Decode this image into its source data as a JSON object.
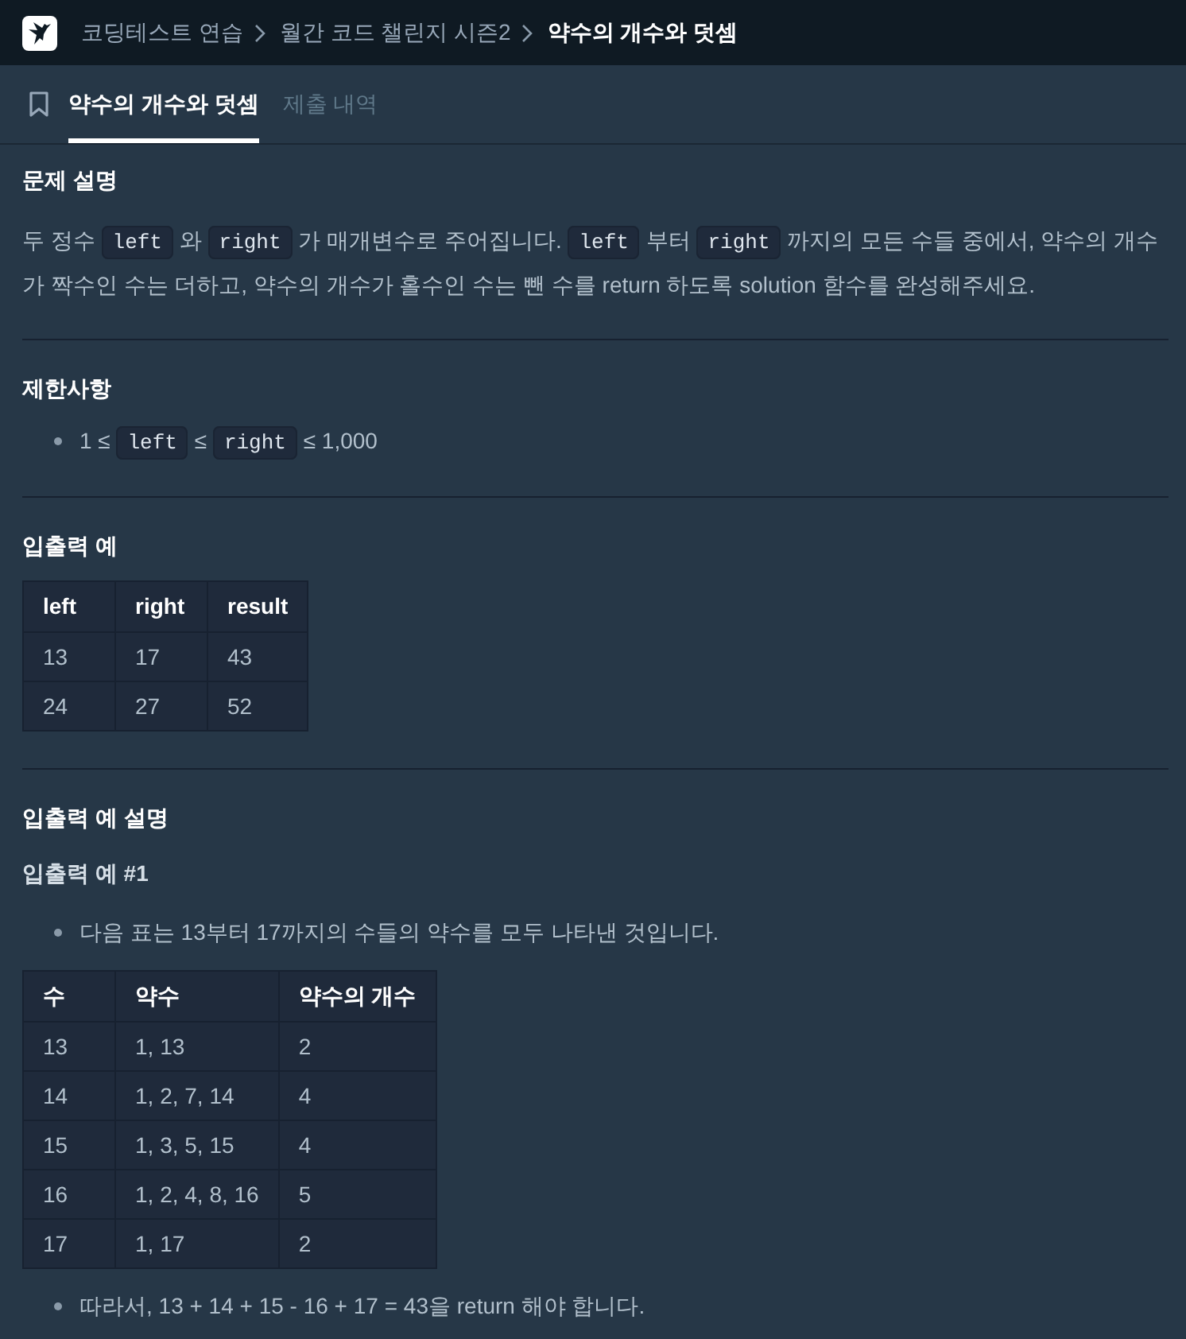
{
  "breadcrumb": [
    {
      "label": "코딩테스트 연습",
      "current": false
    },
    {
      "label": "월간 코드 챌린지 시즌2",
      "current": false
    },
    {
      "label": "약수의 개수와 덧셈",
      "current": true
    }
  ],
  "tabs": [
    {
      "label": "약수의 개수와 덧셈",
      "selected": true
    },
    {
      "label": "제출 내역",
      "selected": false
    }
  ],
  "sections": [
    {
      "title": "문제 설명",
      "blocks": [
        {
          "kind": "paragraph",
          "segments": [
            {
              "kind": "text",
              "text": "두 정수 "
            },
            {
              "kind": "code",
              "text": "left"
            },
            {
              "kind": "text",
              "text": " 와 "
            },
            {
              "kind": "code",
              "text": "right"
            },
            {
              "kind": "text",
              "text": " 가 매개변수로 주어집니다. "
            },
            {
              "kind": "code",
              "text": "left"
            },
            {
              "kind": "text",
              "text": " 부터 "
            },
            {
              "kind": "code",
              "text": "right"
            },
            {
              "kind": "text",
              "text": " 까지의 모든 수들 중에서, 약수의 개수가 짝수인 수는 더하고, 약수의 개수가 홀수인 수는 뺀 수를 return 하도록 solution 함수를 완성해주세요."
            }
          ]
        }
      ]
    },
    {
      "title": "제한사항",
      "blocks": [
        {
          "kind": "bullets",
          "items": [
            {
              "segments": [
                {
                  "kind": "text",
                  "text": "1 ≤ "
                },
                {
                  "kind": "code",
                  "text": "left"
                },
                {
                  "kind": "text",
                  "text": " ≤ "
                },
                {
                  "kind": "code",
                  "text": "right"
                },
                {
                  "kind": "text",
                  "text": " ≤ 1,000"
                }
              ]
            }
          ]
        }
      ]
    },
    {
      "title": "입출력 예",
      "blocks": [
        {
          "kind": "table",
          "columns": [
            "left",
            "right",
            "result"
          ],
          "rows": [
            [
              "13",
              "17",
              "43"
            ],
            [
              "24",
              "27",
              "52"
            ]
          ]
        }
      ]
    },
    {
      "title": "입출력 예 설명",
      "blocks": [
        {
          "kind": "subheading",
          "text": "입출력 예 #1"
        },
        {
          "kind": "bullets",
          "items": [
            {
              "segments": [
                {
                  "kind": "text",
                  "text": "다음 표는 13부터 17까지의 수들의 약수를 모두 나타낸 것입니다."
                }
              ]
            }
          ]
        },
        {
          "kind": "table",
          "columns": [
            "수",
            "약수",
            "약수의 개수"
          ],
          "rows": [
            [
              "13",
              "1, 13",
              "2"
            ],
            [
              "14",
              "1, 2, 7, 14",
              "4"
            ],
            [
              "15",
              "1, 3, 5, 15",
              "4"
            ],
            [
              "16",
              "1, 2, 4, 8, 16",
              "5"
            ],
            [
              "17",
              "1, 17",
              "2"
            ]
          ]
        },
        {
          "kind": "bullets",
          "items": [
            {
              "segments": [
                {
                  "kind": "text",
                  "text": "따라서, 13 + 14 + 15 - 16 + 17 = 43을 return 해야 합니다."
                }
              ]
            }
          ]
        }
      ]
    }
  ]
}
